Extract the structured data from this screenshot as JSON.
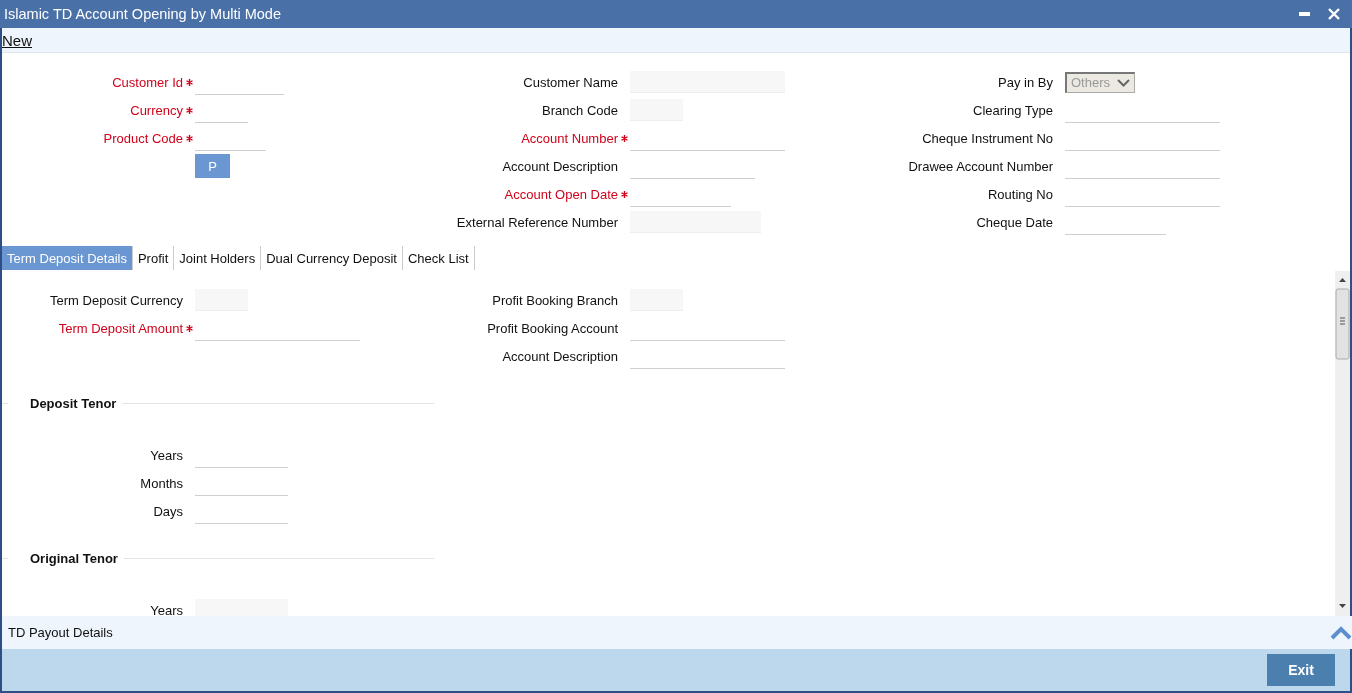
{
  "window": {
    "title": "Islamic TD Account Opening by Multi Mode"
  },
  "toolbar": {
    "new_link": "New"
  },
  "header": {
    "columns": [
      [
        {
          "label": "Customer Id",
          "required": true,
          "kind": "line"
        },
        {
          "label": "Currency",
          "required": true,
          "kind": "line"
        },
        {
          "label": "Product Code",
          "required": true,
          "kind": "line"
        }
      ],
      [
        {
          "label": "Customer Name",
          "required": false,
          "kind": "disabled"
        },
        {
          "label": "Branch Code",
          "required": false,
          "kind": "disabled"
        },
        {
          "label": "Account Number",
          "required": true,
          "kind": "line"
        },
        {
          "label": "Account Description",
          "required": false,
          "kind": "line"
        },
        {
          "label": "Account Open Date",
          "required": true,
          "kind": "line"
        },
        {
          "label": "External Reference Number",
          "required": false,
          "kind": "disabled"
        }
      ],
      [
        {
          "label": "Pay in By",
          "required": false,
          "kind": "select",
          "value": "Others"
        },
        {
          "label": "Clearing Type",
          "required": false,
          "kind": "line"
        },
        {
          "label": "Cheque Instrument No",
          "required": false,
          "kind": "line"
        },
        {
          "label": "Drawee Account Number",
          "required": false,
          "kind": "line"
        },
        {
          "label": "Routing No",
          "required": false,
          "kind": "line"
        },
        {
          "label": "Cheque Date",
          "required": false,
          "kind": "line"
        }
      ]
    ],
    "p_button": "P"
  },
  "tabs": [
    {
      "label": "Term Deposit Details",
      "selected": true
    },
    {
      "label": "Profit",
      "selected": false
    },
    {
      "label": "Joint Holders",
      "selected": false
    },
    {
      "label": "Dual Currency Deposit",
      "selected": false
    },
    {
      "label": "Check List",
      "selected": false
    }
  ],
  "details": {
    "left": [
      {
        "label": "Term Deposit Currency",
        "required": false,
        "kind": "disabled"
      },
      {
        "label": "Term Deposit Amount",
        "required": true,
        "kind": "line"
      }
    ],
    "right": [
      {
        "label": "Profit Booking Branch",
        "required": false,
        "kind": "disabled"
      },
      {
        "label": "Profit Booking Account",
        "required": false,
        "kind": "line"
      },
      {
        "label": "Account Description",
        "required": false,
        "kind": "line"
      }
    ],
    "sections": [
      {
        "title": "Deposit Tenor",
        "fields": [
          {
            "label": "Years",
            "required": false,
            "kind": "line"
          },
          {
            "label": "Months",
            "required": false,
            "kind": "line"
          },
          {
            "label": "Days",
            "required": false,
            "kind": "line"
          }
        ]
      },
      {
        "title": "Original Tenor",
        "fields": [
          {
            "label": "Years",
            "required": false,
            "kind": "disabled"
          }
        ]
      }
    ]
  },
  "payout": {
    "title": "TD Payout Details"
  },
  "footer": {
    "exit_button": "Exit"
  }
}
